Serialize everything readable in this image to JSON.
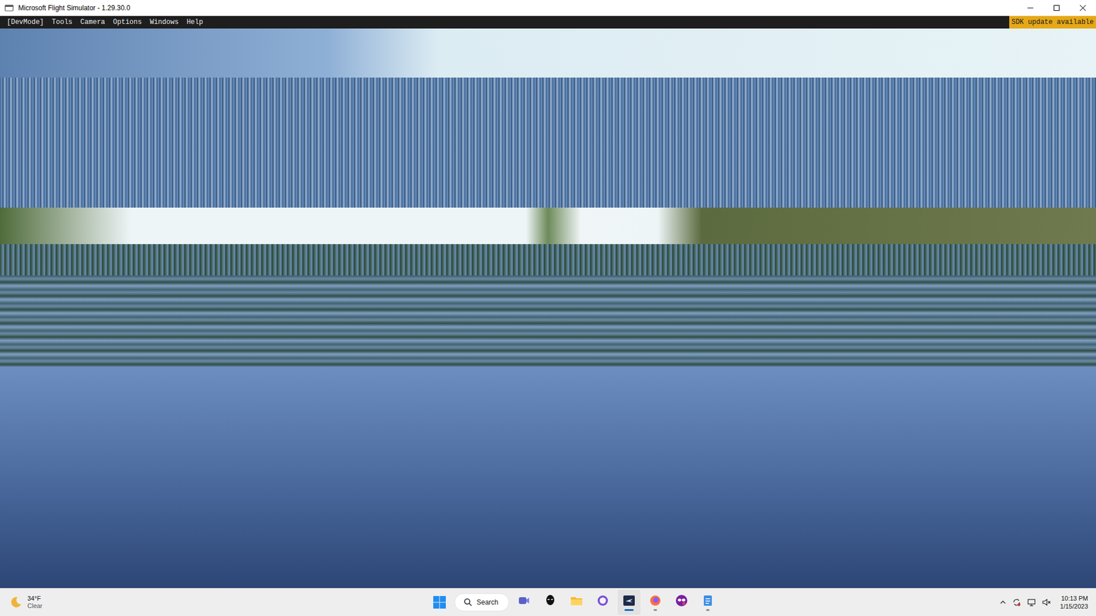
{
  "window": {
    "title": "Microsoft Flight Simulator - 1.29.30.0"
  },
  "dev_menu": {
    "items": [
      "[DevMode]",
      "Tools",
      "Camera",
      "Options",
      "Windows",
      "Help"
    ],
    "badge": "SDK update available"
  },
  "taskbar": {
    "weather": {
      "temperature": "34°F",
      "condition": "Clear"
    },
    "search": {
      "placeholder": "Search"
    },
    "apps": [
      {
        "name": "chat",
        "running": false,
        "selected": false
      },
      {
        "name": "alienware",
        "running": false,
        "selected": false
      },
      {
        "name": "file-explorer",
        "running": false,
        "selected": false
      },
      {
        "name": "circle-app",
        "running": false,
        "selected": false
      },
      {
        "name": "flight-simulator",
        "running": true,
        "selected": true
      },
      {
        "name": "firefox",
        "running": true,
        "selected": false
      },
      {
        "name": "mask-app",
        "running": false,
        "selected": false
      },
      {
        "name": "notepad",
        "running": true,
        "selected": false
      }
    ],
    "clock": {
      "time": "10:13 PM",
      "date": "1/15/2023"
    }
  }
}
